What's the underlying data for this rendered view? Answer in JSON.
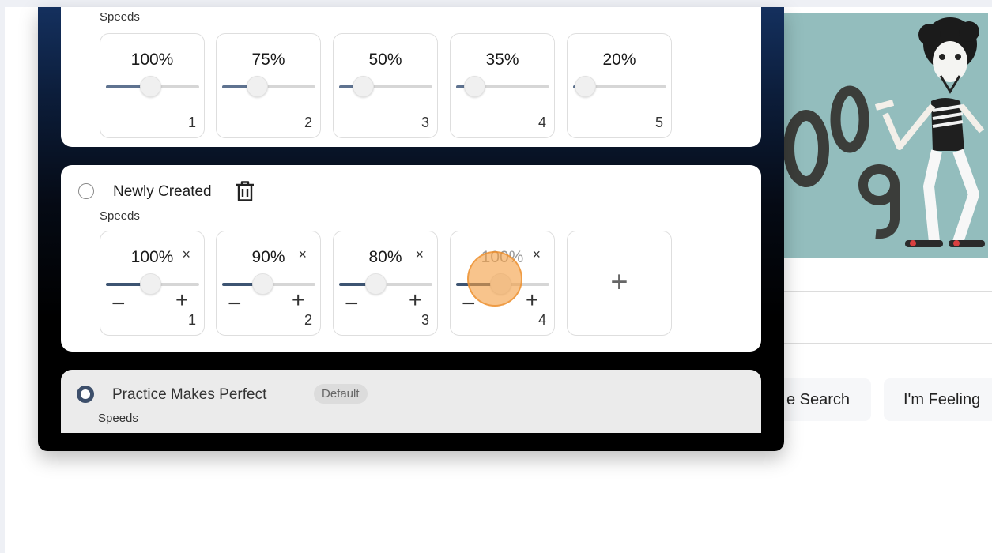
{
  "background": {
    "search_button_partial": "e Search",
    "feeling_lucky_partial": "I'm Feeling"
  },
  "profiles": [
    {
      "speeds_label": "Speeds",
      "speeds": [
        {
          "value": "100%",
          "index": "1",
          "level": 0.5
        },
        {
          "value": "75%",
          "index": "2",
          "level": 0.375
        },
        {
          "value": "50%",
          "index": "3",
          "level": 0.25
        },
        {
          "value": "35%",
          "index": "4",
          "level": 0.175
        },
        {
          "value": "20%",
          "index": "5",
          "level": 0.1
        }
      ]
    },
    {
      "name": "Newly Created",
      "speeds_label": "Speeds",
      "remove_symbol": "×",
      "minus_symbol": "−",
      "plus_symbol": "+",
      "add_symbol": "+",
      "speeds": [
        {
          "value": "100%",
          "index": "1",
          "level": 0.5
        },
        {
          "value": "90%",
          "index": "2",
          "level": 0.45
        },
        {
          "value": "80%",
          "index": "3",
          "level": 0.4
        },
        {
          "value": "100%",
          "index": "4",
          "level": 0.5
        }
      ]
    },
    {
      "name": "Practice Makes Perfect",
      "badge": "Default",
      "speeds_label": "Speeds",
      "selected": true
    }
  ],
  "colors": {
    "slider_fill": "#5f7390",
    "cursor_highlight": "#f4a046",
    "popup_top": "#14305e",
    "doodle_bg": "#93bdbd"
  }
}
